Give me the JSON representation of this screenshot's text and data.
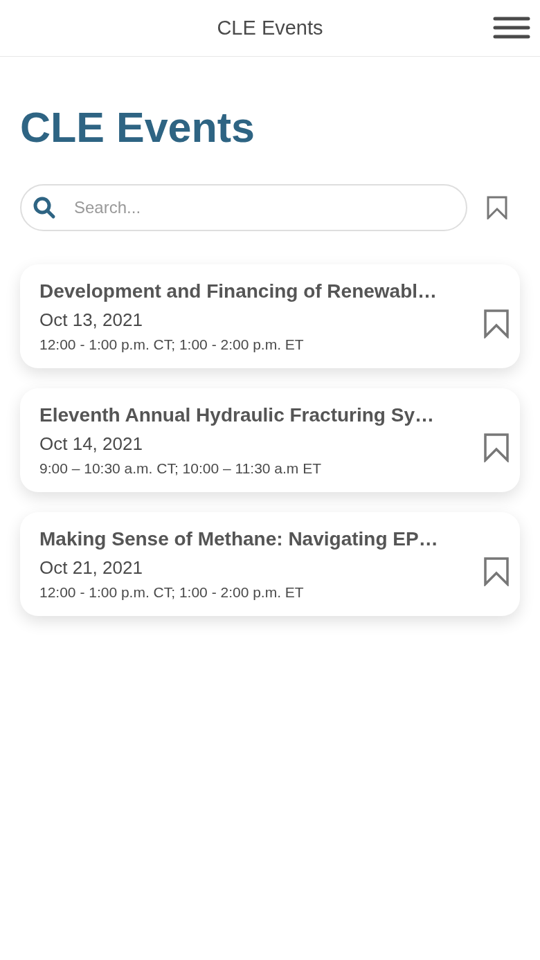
{
  "header": {
    "title": "CLE Events"
  },
  "page_title": "CLE Events",
  "search": {
    "placeholder": "Search..."
  },
  "saved_filter": {
    "selected": false
  },
  "events": [
    {
      "title": "Development and Financing of Renewabl…",
      "date": "Oct 13, 2021",
      "time": "12:00 - 1:00 p.m. CT; 1:00 - 2:00 p.m. ET",
      "bookmarked": false
    },
    {
      "title": "Eleventh Annual Hydraulic Fracturing Sy…",
      "date": "Oct 14, 2021",
      "time": "9:00 – 10:30 a.m. CT; 10:00 – 11:30 a.m ET",
      "bookmarked": false
    },
    {
      "title": "Making Sense of Methane: Navigating EP…",
      "date": "Oct 21, 2021",
      "time": "12:00 - 1:00 p.m. CT; 1:00 - 2:00 p.m. ET",
      "bookmarked": false
    }
  ]
}
